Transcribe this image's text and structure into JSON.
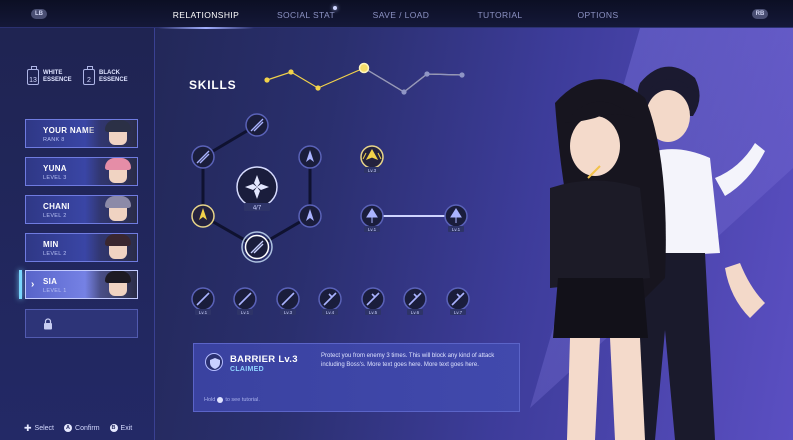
{
  "topbar": {
    "left_shoulder": "LB",
    "right_shoulder": "RB",
    "tabs": [
      {
        "label": "RELATIONSHIP",
        "active": true
      },
      {
        "label": "SOCIAL STAT",
        "active": false,
        "notification": true
      },
      {
        "label": "SAVE / LOAD",
        "active": false
      },
      {
        "label": "TUTORIAL",
        "active": false
      },
      {
        "label": "OPTIONS",
        "active": false
      }
    ]
  },
  "essences": [
    {
      "count": "13",
      "label_line1": "WHITE",
      "label_line2": "ESSENCE"
    },
    {
      "count": "2",
      "label_line1": "BLACK",
      "label_line2": "ESSENCE"
    }
  ],
  "characters": [
    {
      "name": "YOUR NAME",
      "sub": "RANK 8",
      "hair": "#2b3046",
      "selected": false
    },
    {
      "name": "YUNA",
      "sub": "LEVEL 3",
      "hair": "#e58da7",
      "selected": false
    },
    {
      "name": "CHANI",
      "sub": "LEVEL 2",
      "hair": "#8c8aa8",
      "selected": false
    },
    {
      "name": "MIN",
      "sub": "LEVEL 2",
      "hair": "#3a2730",
      "selected": false
    },
    {
      "name": "SIA",
      "sub": "LEVEL 1",
      "hair": "#1d1a24",
      "selected": true
    }
  ],
  "locked_slot_icon": "lock-icon",
  "skills": {
    "title": "SKILLS",
    "center_badge": "4/7",
    "single_node_label": "Lv.3",
    "pair_labels": [
      "Lv.1",
      "Lv.1"
    ],
    "row_labels": [
      "Lv.1",
      "Lv.1",
      "Lv.3",
      "Lv.4",
      "Lv.5",
      "Lv.6",
      "Lv.7"
    ]
  },
  "info": {
    "title": "BARRIER Lv.3",
    "status": "CLAIMED",
    "description": "Protect you from enemy 3 times. This will block any kind of attack including Boss's. More text goes here. More text goes here.",
    "hint_before": "Hold",
    "hint_after": "to see tutorial."
  },
  "footer": {
    "select": "Select",
    "confirm": "Confirm",
    "exit": "Exit",
    "confirm_button": "A",
    "exit_button": "B"
  },
  "colors": {
    "accent": "#7ad7ff",
    "gold": "#f2d24a",
    "panel": "#232966"
  }
}
